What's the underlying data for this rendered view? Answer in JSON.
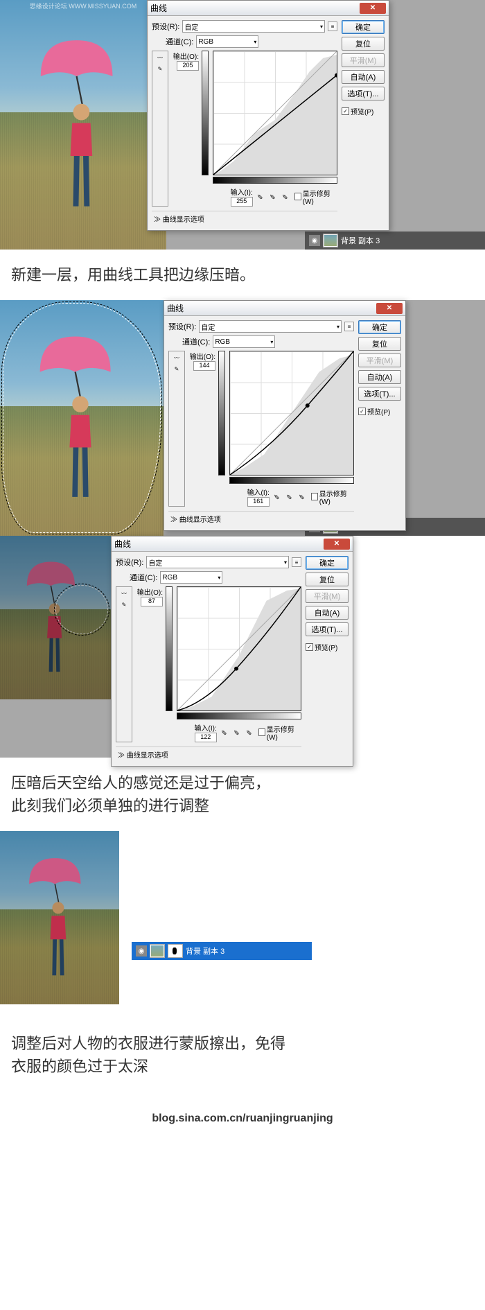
{
  "watermark": "思缘设计论坛  WWW.MISSYUAN.COM",
  "dialog": {
    "title": "曲线",
    "preset_label": "预设(R):",
    "preset_value": "自定",
    "channel_label": "通道(C):",
    "channel_value": "RGB",
    "output_label": "输出(O):",
    "input_label": "输入(I):",
    "clip_label": "显示修剪 (W)",
    "expand": "曲线显示选项",
    "btn_ok": "确定",
    "btn_cancel": "复位",
    "btn_smooth": "平滑(M)",
    "btn_auto": "自动(A)",
    "btn_options": "选项(T)...",
    "preview_label": "预览(P)"
  },
  "sets": [
    {
      "output": "205",
      "input": "255"
    },
    {
      "output": "144",
      "input": "161"
    },
    {
      "output": "87",
      "input": "122"
    }
  ],
  "captions": {
    "c1": "新建一层，用曲线工具把边缘压暗。",
    "c2a": "压暗后天空给人的感觉还是过于偏亮，",
    "c2b": "此刻我们必须单独的进行调整",
    "c3a": "调整后对人物的衣服进行蒙版擦出，免得",
    "c3b": "衣服的颜色过于太深"
  },
  "layer_name": "背景 副本 3",
  "footer": "blog.sina.com.cn/ruanjingruanjing",
  "chart_data": [
    {
      "type": "line",
      "title": "Curves RGB",
      "xlabel": "Input",
      "ylabel": "Output",
      "xlim": [
        0,
        255
      ],
      "ylim": [
        0,
        255
      ],
      "points": [
        [
          0,
          0
        ],
        [
          255,
          205
        ]
      ]
    },
    {
      "type": "line",
      "title": "Curves RGB",
      "xlabel": "Input",
      "ylabel": "Output",
      "xlim": [
        0,
        255
      ],
      "ylim": [
        0,
        255
      ],
      "points": [
        [
          0,
          0
        ],
        [
          161,
          144
        ],
        [
          255,
          255
        ]
      ]
    },
    {
      "type": "line",
      "title": "Curves RGB",
      "xlabel": "Input",
      "ylabel": "Output",
      "xlim": [
        0,
        255
      ],
      "ylim": [
        0,
        255
      ],
      "points": [
        [
          0,
          0
        ],
        [
          122,
          87
        ],
        [
          255,
          255
        ]
      ]
    }
  ]
}
